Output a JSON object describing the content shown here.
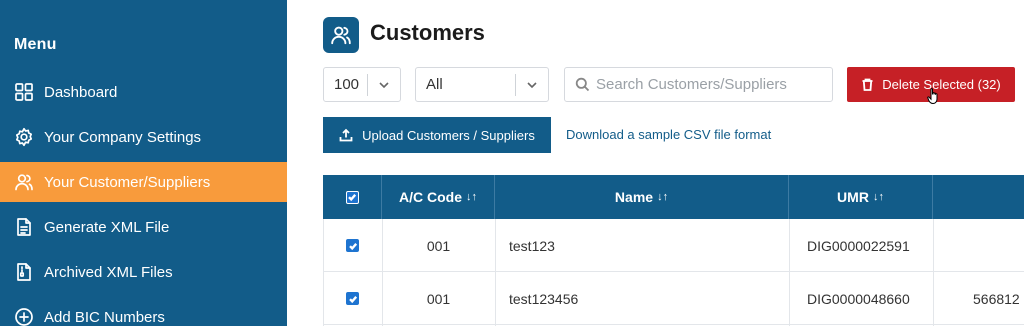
{
  "sidebar": {
    "title": "Menu",
    "items": [
      {
        "label": "Dashboard",
        "icon": "dashboard-icon",
        "active": false
      },
      {
        "label": "Your Company Settings",
        "icon": "gear-icon",
        "active": false
      },
      {
        "label": "Your Customer/Suppliers",
        "icon": "users-icon",
        "active": true
      },
      {
        "label": "Generate XML File",
        "icon": "document-icon",
        "active": false
      },
      {
        "label": "Archived XML Files",
        "icon": "archive-file-icon",
        "active": false
      },
      {
        "label": "Add BIC Numbers",
        "icon": "plus-circle-icon",
        "active": false
      }
    ],
    "colors": {
      "background": "#125c89",
      "active": "#f89b3c"
    }
  },
  "header": {
    "title": "Customers",
    "icon": "users-icon"
  },
  "toolbar": {
    "page_size": "100",
    "filter": "All",
    "search_placeholder": "Search Customers/Suppliers",
    "delete_label": "Delete Selected (32)",
    "upload_label": "Upload Customers / Suppliers",
    "sample_link": "Download a sample CSV file format"
  },
  "table": {
    "columns": [
      {
        "label": "",
        "type": "checkbox",
        "checked": true
      },
      {
        "label": "A/C Code",
        "sort": "↓↑"
      },
      {
        "label": "Name",
        "sort": "↓↑"
      },
      {
        "label": "UMR",
        "sort": "↓↑"
      },
      {
        "label": ""
      }
    ],
    "rows": [
      {
        "checked": true,
        "ac_code": "001",
        "name": "test123",
        "umr": "DIG0000022591",
        "extra": ""
      },
      {
        "checked": true,
        "ac_code": "001",
        "name": "test123456",
        "umr": "DIG0000048660",
        "extra": "566812"
      }
    ]
  },
  "colors": {
    "primary": "#125c89",
    "danger": "#c62026",
    "checkbox": "#1e74d0"
  }
}
